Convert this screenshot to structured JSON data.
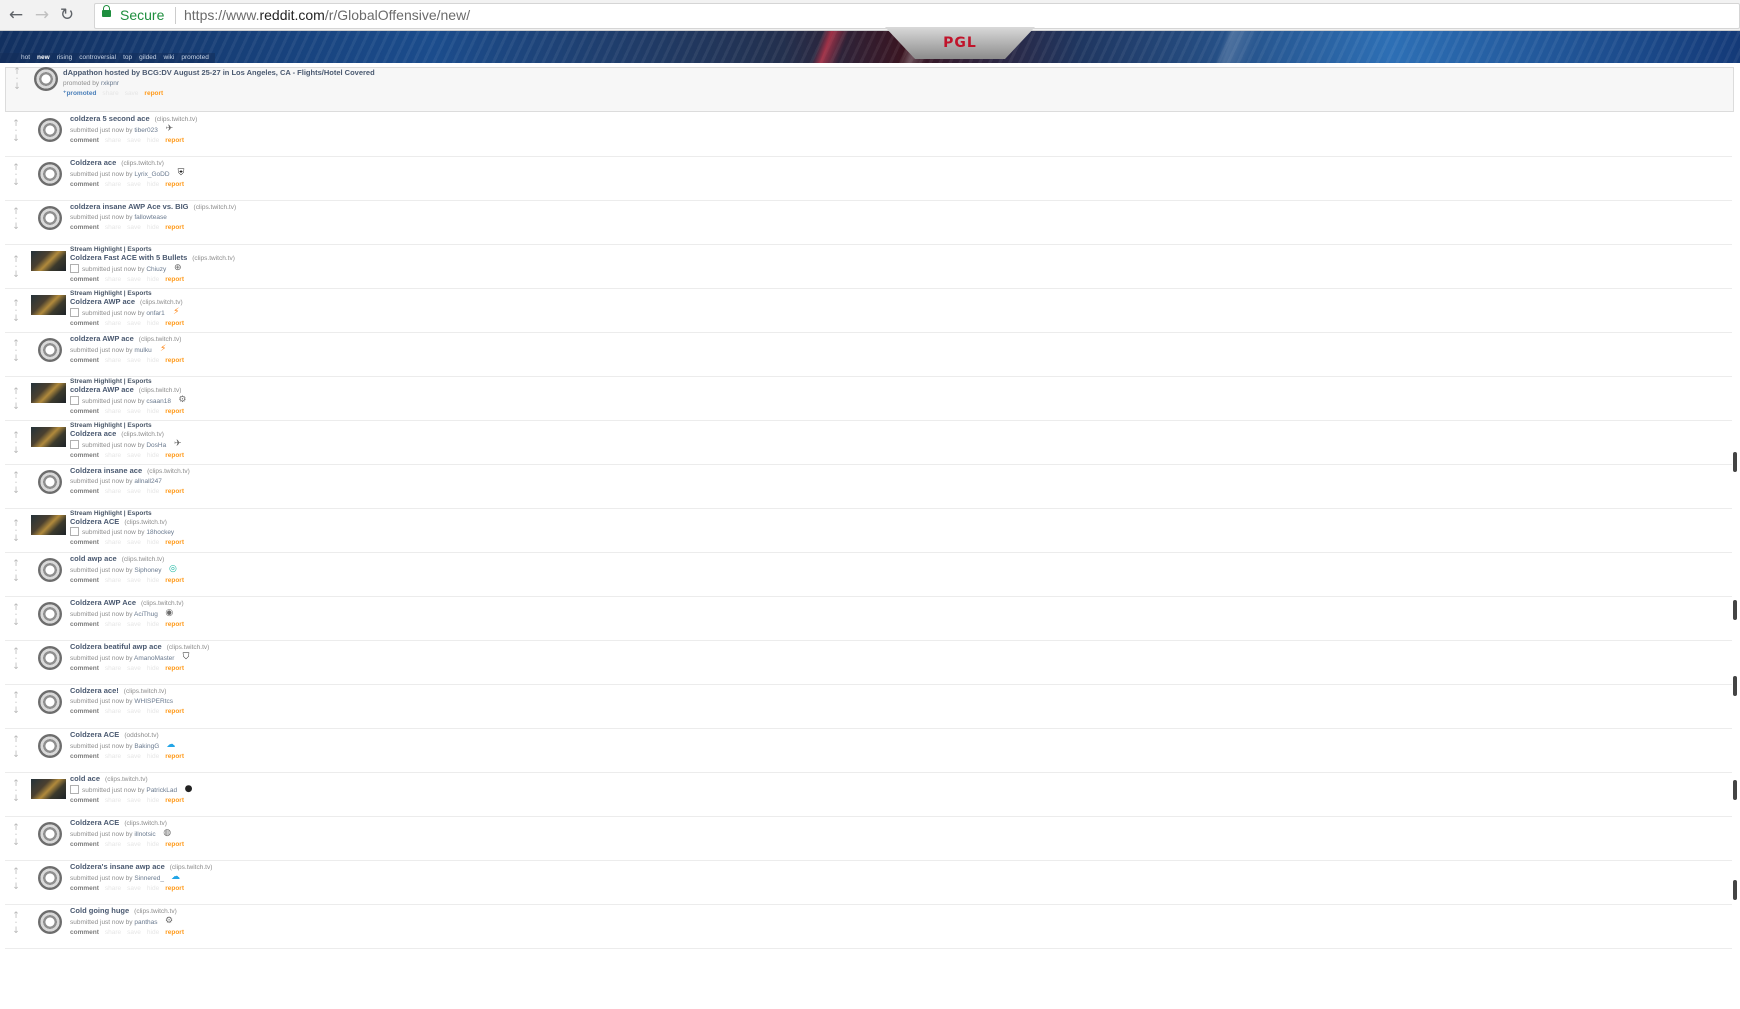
{
  "browser": {
    "back_glyph": "←",
    "forward_glyph": "→",
    "reload_glyph": "↻",
    "secure_label": "Secure",
    "url_scheme": "https://www.",
    "url_host": "reddit.com",
    "url_path": "/r/GlobalOffensive/new/"
  },
  "header": {
    "banner_logo_text": "PGL",
    "tabs": [
      {
        "label": "hot",
        "selected": false
      },
      {
        "label": "new",
        "selected": true
      },
      {
        "label": "rising",
        "selected": false
      },
      {
        "label": "controversial",
        "selected": false
      },
      {
        "label": "top",
        "selected": false
      },
      {
        "label": "gilded",
        "selected": false
      },
      {
        "label": "wiki",
        "selected": false
      },
      {
        "label": "promoted",
        "selected": false
      }
    ]
  },
  "promoted_post": {
    "title": "dAppathon hosted by BCG:DV August 25-27 in Los Angeles, CA - Flights/Hotel Covered",
    "tagline": "promoted by",
    "author": "rxkpnr",
    "badge": "promoted",
    "report": "report"
  },
  "common": {
    "comment": "comment",
    "report": "report",
    "share": "share",
    "save": "save",
    "hide": "hide",
    "submitted": "submitted",
    "just_now": "just now",
    "by": "by"
  },
  "posts": [
    {
      "title": "coldzera 5 second ace",
      "domain": "clips.twitch.tv",
      "author": "tiber023",
      "flair": "",
      "thumb": "default",
      "user_flair": "✈",
      "user_flair_class": "gray"
    },
    {
      "title": "Coldzera ace",
      "domain": "clips.twitch.tv",
      "author": "Lyrix_GoDD",
      "flair": "",
      "thumb": "default",
      "user_flair": "⛨",
      "user_flair_class": "dark"
    },
    {
      "title": "coldzera insane AWP Ace vs. BIG",
      "domain": "clips.twitch.tv",
      "author": "fallowtease",
      "flair": "",
      "thumb": "default",
      "user_flair": "",
      "user_flair_class": ""
    },
    {
      "title": "Coldzera Fast ACE with 5 Bullets",
      "domain": "clips.twitch.tv",
      "author": "Chiuzy",
      "flair": "Stream Highlight | Esports",
      "thumb": "video",
      "user_flair": "⊕",
      "user_flair_class": "gray"
    },
    {
      "title": "Coldzera AWP ace",
      "domain": "clips.twitch.tv",
      "author": "onfar1",
      "flair": "Stream Highlight | Esports",
      "thumb": "video",
      "user_flair": "⚡",
      "user_flair_class": "fnatic"
    },
    {
      "title": "coldzera AWP ace",
      "domain": "clips.twitch.tv",
      "author": "mulku",
      "flair": "",
      "thumb": "default",
      "user_flair": "⚡",
      "user_flair_class": "fnatic"
    },
    {
      "title": "coldzera AWP ace",
      "domain": "clips.twitch.tv",
      "author": "csaan18",
      "flair": "Stream Highlight | Esports",
      "thumb": "video",
      "user_flair": "⚙",
      "user_flair_class": "gray"
    },
    {
      "title": "Coldzera ace",
      "domain": "clips.twitch.tv",
      "author": "DosHa",
      "flair": "Stream Highlight | Esports",
      "thumb": "video",
      "user_flair": "✈",
      "user_flair_class": "gray"
    },
    {
      "title": "Coldzera insane ace",
      "domain": "clips.twitch.tv",
      "author": "allnall247",
      "flair": "",
      "thumb": "default",
      "user_flair": "",
      "user_flair_class": ""
    },
    {
      "title": "Coldzera ACE",
      "domain": "clips.twitch.tv",
      "author": "18hockey",
      "flair": "Stream Highlight | Esports",
      "thumb": "video",
      "user_flair": "",
      "user_flair_class": ""
    },
    {
      "title": "cold awp ace",
      "domain": "clips.twitch.tv",
      "author": "Siphoney",
      "flair": "",
      "thumb": "default",
      "user_flair": "◎",
      "user_flair_class": "globe"
    },
    {
      "title": "Coldzera AWP Ace",
      "domain": "clips.twitch.tv",
      "author": "AciThug",
      "flair": "",
      "thumb": "default",
      "user_flair": "◉",
      "user_flair_class": "gray"
    },
    {
      "title": "Coldzera beatiful awp ace",
      "domain": "clips.twitch.tv",
      "author": "AmanoMaster",
      "flair": "",
      "thumb": "default",
      "user_flair": "⛉",
      "user_flair_class": "dark"
    },
    {
      "title": "Coldzera ace!",
      "domain": "clips.twitch.tv",
      "author": "WHISPERtcs",
      "flair": "",
      "thumb": "default",
      "user_flair": "",
      "user_flair_class": ""
    },
    {
      "title": "Coldzera ACE",
      "domain": "oddshot.tv",
      "author": "BakingG",
      "flair": "",
      "thumb": "default",
      "user_flair": "☁",
      "user_flair_class": "cloud9"
    },
    {
      "title": "cold ace",
      "domain": "clips.twitch.tv",
      "author": "PatrickLad",
      "flair": "",
      "thumb": "video",
      "user_flair": "●",
      "user_flair_class": "dark"
    },
    {
      "title": "Coldzera ACE",
      "domain": "clips.twitch.tv",
      "author": "illnotsic",
      "flair": "",
      "thumb": "default",
      "user_flair": "◍",
      "user_flair_class": "gray"
    },
    {
      "title": "Coldzera's insane awp ace",
      "domain": "clips.twitch.tv",
      "author": "Sinnered_",
      "flair": "",
      "thumb": "default",
      "user_flair": "☁",
      "user_flair_class": "cloud9"
    },
    {
      "title": "Cold going huge",
      "domain": "clips.twitch.tv",
      "author": "panthas",
      "flair": "",
      "thumb": "default",
      "user_flair": "⚙",
      "user_flair_class": "gray"
    }
  ]
}
